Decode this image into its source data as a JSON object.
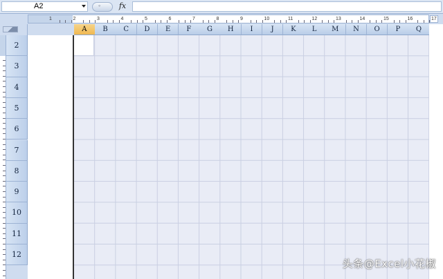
{
  "formula_bar": {
    "name_box_value": "A2",
    "fx_label": "fx",
    "formula_value": ""
  },
  "ruler": {
    "top_numbers": [
      "1",
      "2",
      "3",
      "4",
      "5",
      "6",
      "7",
      "8",
      "9",
      "10",
      "11",
      "12",
      "13",
      "14",
      "15",
      "16"
    ],
    "end_label": "17"
  },
  "columns": [
    "A",
    "B",
    "C",
    "D",
    "E",
    "F",
    "G",
    "H",
    "I",
    "J",
    "K",
    "L",
    "M",
    "N",
    "O",
    "P",
    "Q"
  ],
  "rows": [
    "2",
    "3",
    "4",
    "5",
    "6",
    "7",
    "8",
    "9",
    "10",
    "11",
    "12"
  ],
  "active_cell": {
    "ref": "A2",
    "column": "A",
    "row": "2"
  },
  "view": {
    "mode": "Page Layout"
  },
  "watermark": "头条@Excel小花椒",
  "colors": {
    "grid_background": "#e9ecf6",
    "gridline": "#c9cfe2",
    "header_background": "#cfdcef",
    "header_border": "#9db3d4"
  }
}
